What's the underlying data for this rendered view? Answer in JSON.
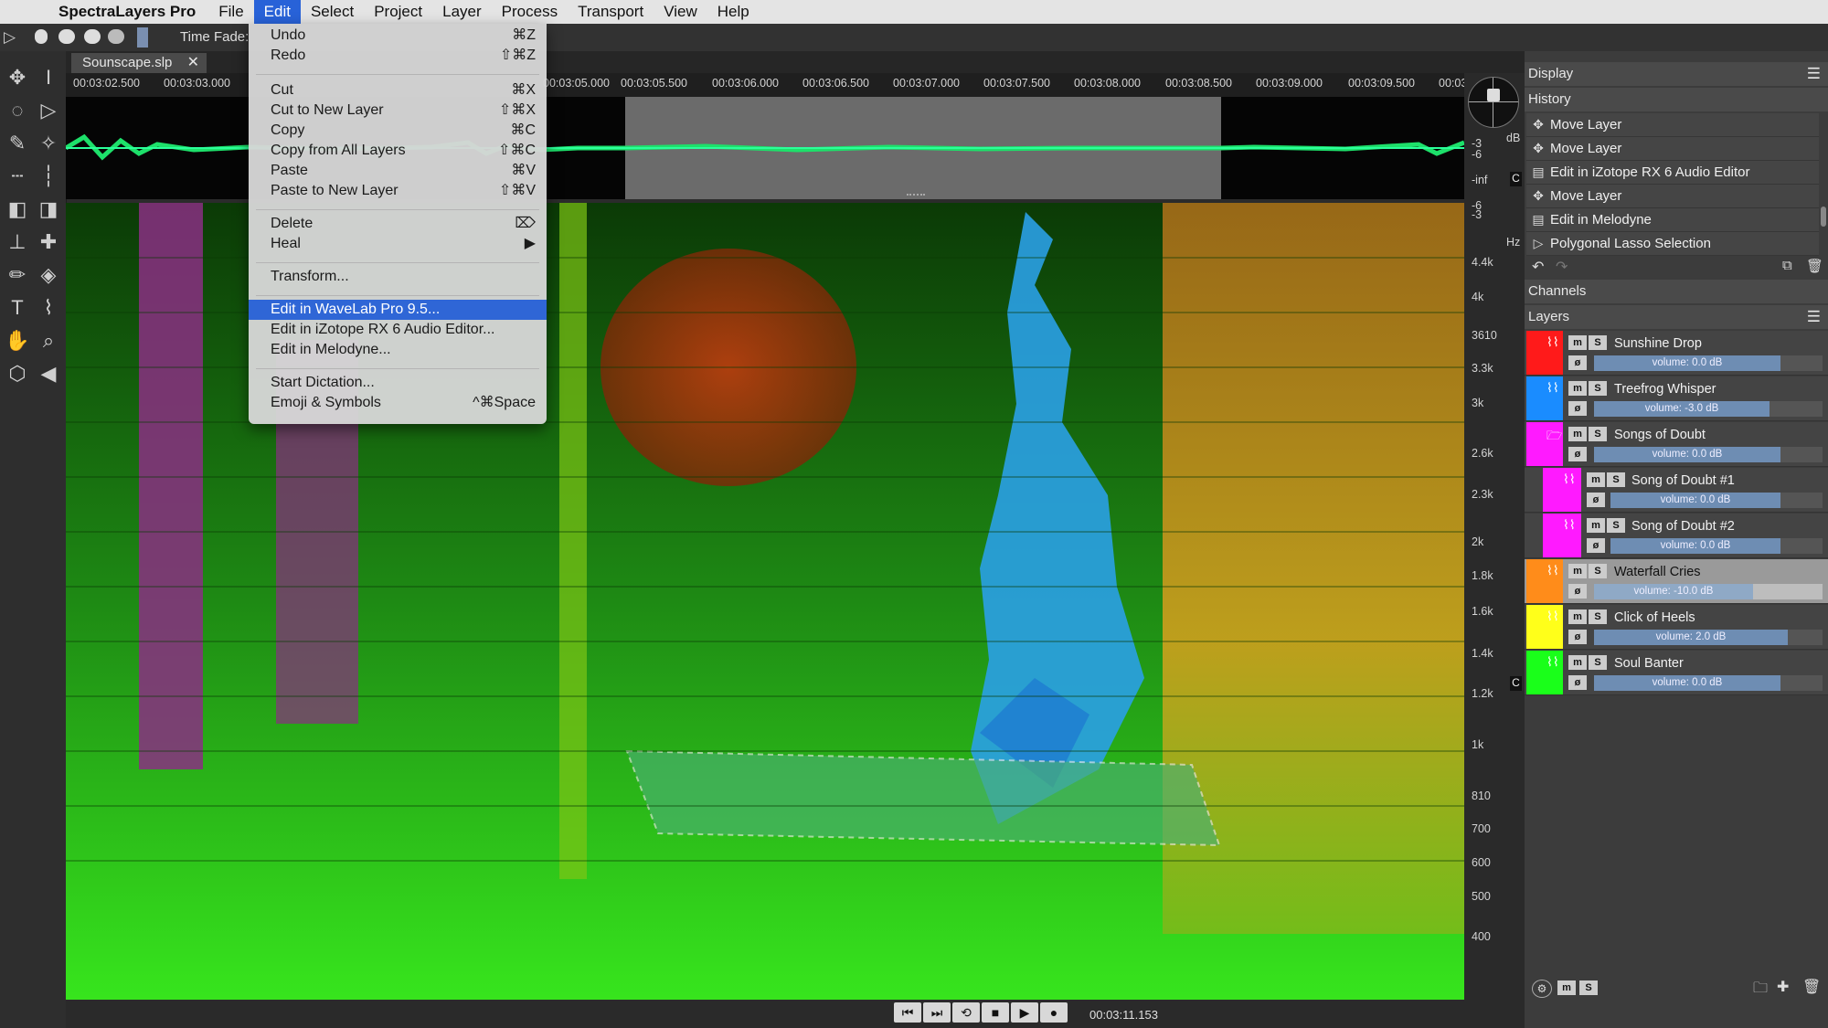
{
  "menubar": {
    "app": "SpectraLayers Pro",
    "items": [
      "File",
      "Edit",
      "Select",
      "Project",
      "Layer",
      "Process",
      "Transport",
      "View",
      "Help"
    ],
    "active": "Edit"
  },
  "toolbar": {
    "time_fade_label": "Time Fade:"
  },
  "tab": {
    "label": "Sounscape.slp",
    "close": "✕"
  },
  "ruler": {
    "ticks": [
      "00:03:02.500",
      "00:03:03.000",
      "00:03:05.000",
      "00:03:05.500",
      "00:03:06.000",
      "00:03:06.500",
      "00:03:07.000",
      "00:03:07.500",
      "00:03:08.000",
      "00:03:08.500",
      "00:03:09.000",
      "00:03:09.500",
      "00:03:"
    ]
  },
  "scale": {
    "db_unit": "dB",
    "hz_unit": "Hz",
    "db_ticks": [
      "-3",
      "-6",
      "-inf",
      "-6",
      "-3"
    ],
    "hz_ticks": [
      "4.4k",
      "4k",
      "3610",
      "3.3k",
      "3k",
      "2.6k",
      "2.3k",
      "2k",
      "1.8k",
      "1.6k",
      "1.4k",
      "1.2k",
      "1k",
      "810",
      "700",
      "600",
      "500",
      "400"
    ],
    "c_label": "C"
  },
  "edit_menu": {
    "items": [
      {
        "label": "Undo",
        "shortcut": "⌘Z"
      },
      {
        "label": "Redo",
        "shortcut": "⇧⌘Z"
      },
      {
        "label": "Cut",
        "shortcut": "⌘X"
      },
      {
        "label": "Cut to New Layer",
        "shortcut": "⇧⌘X"
      },
      {
        "label": "Copy",
        "shortcut": "⌘C"
      },
      {
        "label": "Copy from All Layers",
        "shortcut": "⇧⌘C"
      },
      {
        "label": "Paste",
        "shortcut": "⌘V"
      },
      {
        "label": "Paste to New Layer",
        "shortcut": "⇧⌘V"
      },
      {
        "label": "Delete",
        "shortcut": "⌦"
      },
      {
        "label": "Heal",
        "shortcut": "▶"
      },
      {
        "label": "Transform...",
        "shortcut": ""
      },
      {
        "label": "Edit in WaveLab Pro 9.5...",
        "shortcut": ""
      },
      {
        "label": "Edit in iZotope RX 6 Audio Editor...",
        "shortcut": ""
      },
      {
        "label": "Edit in Melodyne...",
        "shortcut": ""
      },
      {
        "label": "Start Dictation...",
        "shortcut": ""
      },
      {
        "label": "Emoji & Symbols",
        "shortcut": "^⌘Space"
      }
    ],
    "highlighted": "Edit in WaveLab Pro 9.5..."
  },
  "panel": {
    "display_label": "Display",
    "history_label": "History",
    "history": [
      {
        "icon": "move-icon",
        "label": "Move Layer"
      },
      {
        "icon": "move-icon",
        "label": "Move Layer"
      },
      {
        "icon": "edit-icon",
        "label": "Edit in iZotope RX 6 Audio Editor"
      },
      {
        "icon": "move-icon",
        "label": "Move Layer"
      },
      {
        "icon": "edit-icon",
        "label": "Edit in Melodyne"
      },
      {
        "icon": "lasso-icon",
        "label": "Polygonal Lasso Selection"
      }
    ],
    "channels_label": "Channels",
    "layers_label": "Layers",
    "mute_label": "m",
    "solo_label": "S",
    "layers": [
      {
        "name": "Sunshine Drop",
        "color": "#ff1a1a",
        "volume": "volume: 0.0 dB",
        "level": 0.7,
        "selected": false,
        "indent": false,
        "type": "wave"
      },
      {
        "name": "Treefrog Whisper",
        "color": "#1a8cff",
        "volume": "volume: -3.0 dB",
        "level": 0.66,
        "selected": false,
        "indent": false,
        "type": "wave"
      },
      {
        "name": "Songs of Doubt",
        "color": "#ff1aff",
        "volume": "volume: 0.0 dB",
        "level": 0.7,
        "selected": false,
        "indent": false,
        "type": "folder"
      },
      {
        "name": "Song of Doubt #1",
        "color": "#ff1aff",
        "volume": "volume: 0.0 dB",
        "level": 0.7,
        "selected": false,
        "indent": true,
        "type": "wave"
      },
      {
        "name": "Song of Doubt #2",
        "color": "#ff1aff",
        "volume": "volume: 0.0 dB",
        "level": 0.7,
        "selected": false,
        "indent": true,
        "type": "wave"
      },
      {
        "name": "Waterfall Cries",
        "color": "#ff8c1a",
        "volume": "volume: -10.0 dB",
        "level": 0.55,
        "selected": true,
        "indent": false,
        "type": "wave"
      },
      {
        "name": "Click of Heels",
        "color": "#ffff1a",
        "volume": "volume: 2.0 dB",
        "level": 0.74,
        "selected": false,
        "indent": false,
        "type": "wave"
      },
      {
        "name": "Soul Banter",
        "color": "#1aff1a",
        "volume": "volume: 0.0 dB",
        "level": 0.7,
        "selected": false,
        "indent": false,
        "type": "wave"
      }
    ]
  },
  "transport": {
    "timecode": "00:03:11.153"
  }
}
